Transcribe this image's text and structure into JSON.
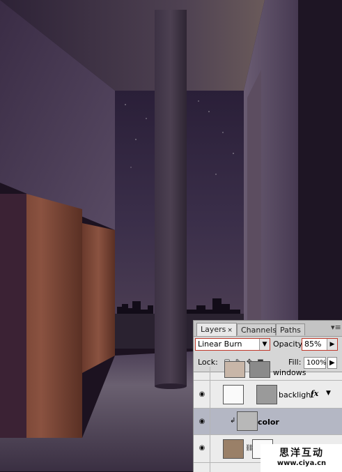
{
  "layers_panel": {
    "tabs": [
      {
        "label": "Layers",
        "close": "×"
      },
      {
        "label": "Channels"
      },
      {
        "label": "Paths"
      }
    ],
    "menu_glyph": "▾≡",
    "blend_mode": "Linear Burn",
    "opacity_label": "Opacity:",
    "opacity_value": "85%",
    "lock_label": "Lock:",
    "fill_label": "Fill:",
    "fill_value": "100%",
    "layers": [
      {
        "name": "windows",
        "visible": true
      },
      {
        "name": "backlight",
        "visible": true,
        "fx": "fx"
      },
      {
        "name": "color",
        "visible": true,
        "selected": true,
        "clipped": true
      },
      {
        "name": "",
        "visible": true
      },
      {
        "name": "",
        "visible": true
      }
    ]
  },
  "watermark": {
    "chinese": "思洋互动",
    "url": "www.ciya.cn"
  }
}
